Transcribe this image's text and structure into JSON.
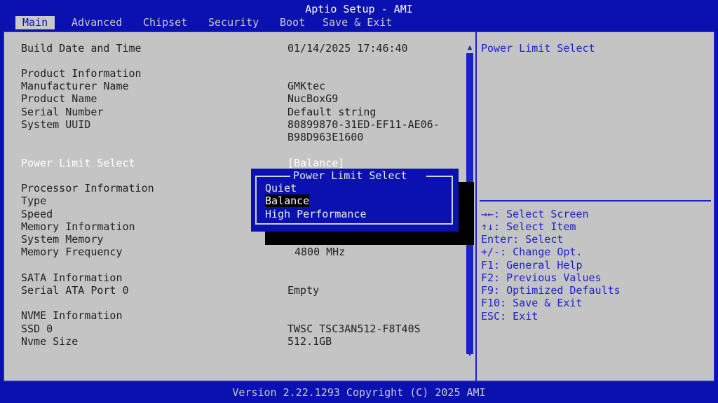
{
  "header": {
    "title": "Aptio Setup - AMI"
  },
  "tabs": [
    {
      "label": "Main"
    },
    {
      "label": "Advanced"
    },
    {
      "label": "Chipset"
    },
    {
      "label": "Security"
    },
    {
      "label": "Boot"
    },
    {
      "label": "Save & Exit"
    }
  ],
  "main": {
    "build_date_label": "Build Date and Time",
    "build_date_value": "01/14/2025 17:46:40",
    "product_info_heading": "Product Information",
    "manufacturer_label": "Manufacturer Name",
    "manufacturer_value": "GMKtec",
    "product_name_label": "Product Name",
    "product_name_value": "NucBoxG9",
    "serial_label": "Serial Number",
    "serial_value": "Default string",
    "uuid_label": "System UUID",
    "uuid_value_line1": "80899870-31ED-EF11-AE06-",
    "uuid_value_line2": "B98D963E1600",
    "power_limit_label": "Power Limit Select",
    "power_limit_value": "[Balance]",
    "processor_heading": "Processor Information",
    "type_label": "Type",
    "speed_label": "Speed",
    "memory_heading": "Memory Information",
    "system_memory_label": "System Memory",
    "memory_freq_label": "Memory Frequency",
    "memory_freq_value": "4800 MHz",
    "sata_heading": "SATA Information",
    "sata_port_label": "Serial ATA Port 0",
    "sata_port_value": "Empty",
    "nvme_heading": "NVME Information",
    "ssd_label": "SSD 0",
    "ssd_value": "TWSC TSC3AN512-F8T40S",
    "nvme_size_label": "Nvme Size",
    "nvme_size_value": "512.1GB"
  },
  "help": {
    "title": "Power Limit Select",
    "keys": [
      "→←: Select Screen",
      "↑↓: Select Item",
      "Enter: Select",
      "+/-: Change Opt.",
      "F1: General Help",
      "F2: Previous Values",
      "F9: Optimized Defaults",
      "F10: Save & Exit",
      "ESC: Exit"
    ]
  },
  "popup": {
    "title": "Power Limit Select",
    "options": [
      "Quiet",
      "Balance",
      "High Performance"
    ],
    "selected": "Balance"
  },
  "footer": {
    "text": "Version 2.22.1293 Copyright (C) 2025 AMI"
  },
  "colors": {
    "background_blue": "#0a11b0",
    "panel_gray": "#c4c4c4",
    "accent_blue": "#1a22c8",
    "highlight_white": "#ffffff"
  }
}
